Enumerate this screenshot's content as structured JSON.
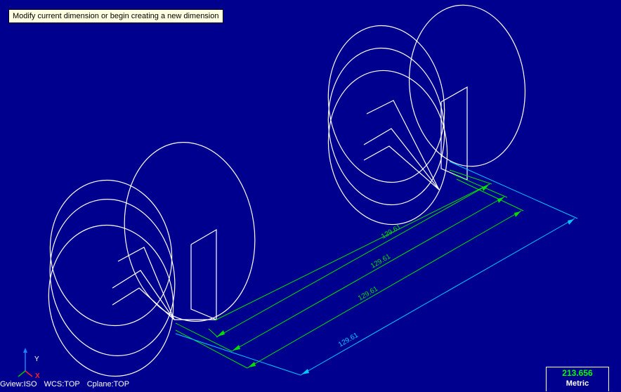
{
  "tooltip": {
    "text": "Modify current dimension or begin creating a new dimension"
  },
  "status_bar": {
    "gview": "Gview:ISO",
    "wcs": "WCS:TOP",
    "cplane": "Cplane:TOP"
  },
  "readout": {
    "value": "213.656",
    "units": "Metric"
  },
  "axes": {
    "y_label": "Y",
    "x_label": "X"
  },
  "dimensions": {
    "labels": [
      "129.61",
      "129.61",
      "129.61",
      "129.61"
    ]
  },
  "colors": {
    "background": "#00008f",
    "geometry": "#ffffff",
    "dimension_green": "#00e000",
    "dimension_cyan": "#00c8ff",
    "x_axis": "#ff2020",
    "y_axis": "#2080ff",
    "z_axis": "#00c000"
  }
}
